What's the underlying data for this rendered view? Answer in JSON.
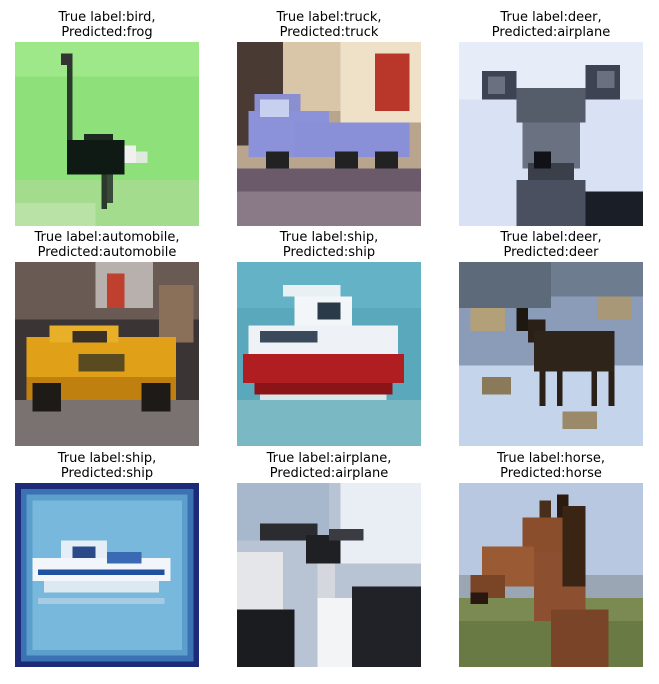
{
  "grid": {
    "items": [
      {
        "true_label": "True label:bird,",
        "predicted": "Predicted:frog",
        "subject": "ostrich-on-grass"
      },
      {
        "true_label": "True label:truck,",
        "predicted": "Predicted:truck",
        "subject": "blue-truck"
      },
      {
        "true_label": "True label:deer,",
        "predicted": "Predicted:airplane",
        "subject": "deer-face"
      },
      {
        "true_label": "True label:automobile,",
        "predicted": "Predicted:automobile",
        "subject": "yellow-sports-car"
      },
      {
        "true_label": "True label:ship,",
        "predicted": "Predicted:ship",
        "subject": "red-white-boat"
      },
      {
        "true_label": "True label:deer,",
        "predicted": "Predicted:deer",
        "subject": "deer-in-snow"
      },
      {
        "true_label": "True label:ship,",
        "predicted": "Predicted:ship",
        "subject": "white-speedboat"
      },
      {
        "true_label": "True label:airplane,",
        "predicted": "Predicted:airplane",
        "subject": "airplane-in-clouds"
      },
      {
        "true_label": "True label:horse,",
        "predicted": "Predicted:horse",
        "subject": "brown-horse"
      }
    ]
  }
}
